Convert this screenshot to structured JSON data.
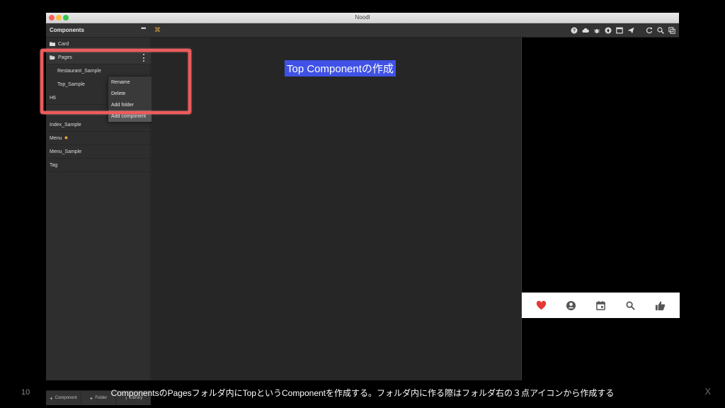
{
  "window": {
    "title": "Noodl"
  },
  "panel": {
    "title": "Components",
    "more_label": "•••"
  },
  "toolbar": {
    "icons": [
      "help-icon",
      "cloud-icon",
      "bug-icon",
      "upload-icon",
      "window-icon",
      "send-icon",
      "refresh-icon",
      "search-icon",
      "frames-icon"
    ]
  },
  "sidebar": {
    "items": [
      {
        "label": "Card",
        "type": "folder"
      },
      {
        "label": "Pages",
        "type": "folder"
      },
      {
        "label": "Restaurant_Sample",
        "type": "component"
      },
      {
        "label": "Top_Sample",
        "type": "component"
      },
      {
        "label": "H6",
        "type": "component"
      },
      {
        "label": "Index_Sample",
        "type": "component"
      },
      {
        "label": "Menu",
        "type": "component"
      },
      {
        "label": "Menu_Sample",
        "type": "component"
      },
      {
        "label": "Tag",
        "type": "component"
      }
    ]
  },
  "context_menu": {
    "items": [
      "Rename",
      "Delete",
      "Add folder",
      "Add component"
    ],
    "highlighted": "Add component"
  },
  "footer": {
    "component_label": "Component",
    "folder_label": "Folder",
    "library_label": "Library"
  },
  "canvas": {
    "label": "Top Componentの作成"
  },
  "preview": {
    "tabs": [
      "heart-icon",
      "account-icon",
      "calendar-icon",
      "search-icon",
      "thumbs-up-icon"
    ],
    "active_color": "#e53935",
    "icon_color": "#555555"
  },
  "slide": {
    "caption": "ComponentsのPagesフォルダ内にTopというComponentを作成する。フォルダ内に作る際はフォルダ右の３点アイコンから作成する",
    "page_number": "10",
    "close_mark": "X"
  },
  "colors": {
    "highlight_border": "#ef5b5b",
    "label_bg": "#4052e6"
  }
}
